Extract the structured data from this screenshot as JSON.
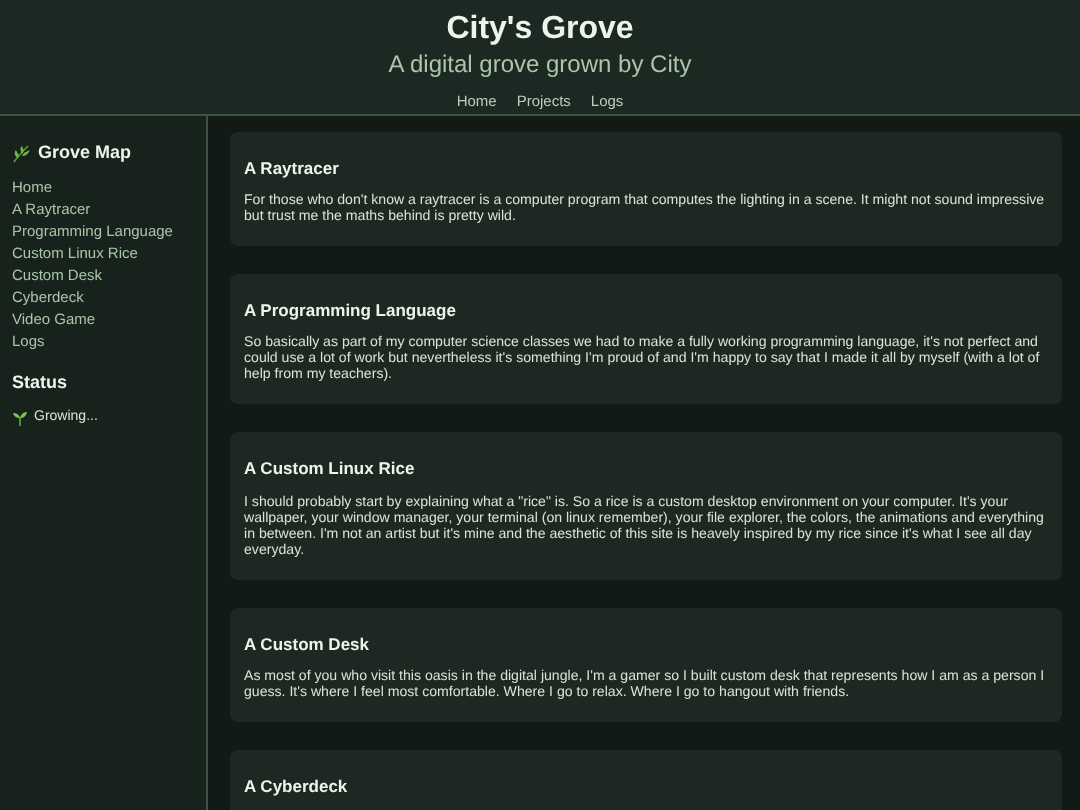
{
  "header": {
    "title": "City's Grove",
    "subtitle": "A digital grove grown by City",
    "nav": [
      "Home",
      "Projects",
      "Logs"
    ]
  },
  "sidebar": {
    "title": "Grove Map",
    "links": [
      "Home",
      "A Raytracer",
      "Programming Language",
      "Custom Linux Rice",
      "Custom Desk",
      "Cyberdeck",
      "Video Game",
      "Logs"
    ],
    "status_title": "Status",
    "status": "Growing..."
  },
  "posts": [
    {
      "title": "A Raytracer",
      "text": "For those who don't know a raytracer is a computer program that computes the lighting in a scene. It might not sound impressive but trust me the maths behind is pretty wild."
    },
    {
      "title": "A Programming Language",
      "text": "So basically as part of my computer science classes we had to make a fully working programming language, it's not perfect and could use a lot of work but nevertheless it's something I'm proud of and I'm happy to say that I made it all by myself (with a lot of help from my teachers)."
    },
    {
      "title": "A Custom Linux Rice",
      "text": "I should probably start by explaining what a \"rice\" is. So a rice is a custom desktop environment on your computer. It's your wallpaper, your window manager, your terminal (on linux remember), your file explorer, the colors, the animations and everything in between. I'm not an artist but it's mine and the aesthetic of this site is heavely inspired by my rice since it's what I see all day everyday."
    },
    {
      "title": "A Custom Desk",
      "text": "As most of you who visit this oasis in the digital jungle, I'm a gamer so I built custom desk that represents how I am as a person I guess. It's where I feel most comfortable. Where I go to relax. Where I go to hangout with friends."
    },
    {
      "title": "A Cyberdeck"
    }
  ]
}
